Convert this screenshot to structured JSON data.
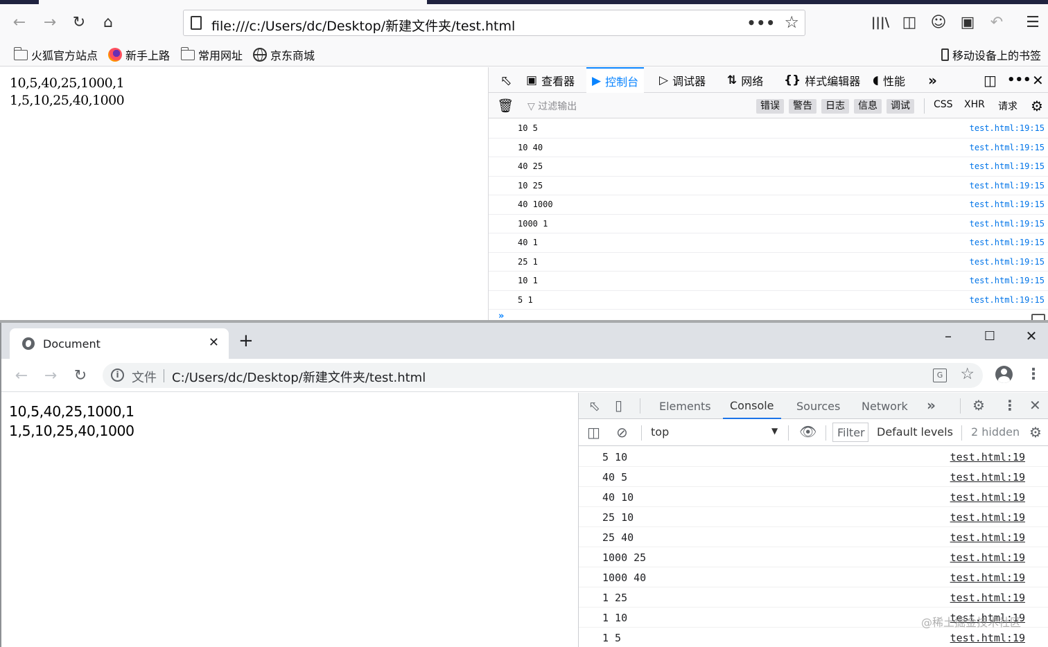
{
  "firefox": {
    "url": "file:///c:/Users/dc/Desktop/新建文件夹/test.html",
    "bookmarks": [
      "火狐官方站点",
      "新手上路",
      "常用网址",
      "京东商城"
    ],
    "mobile_bookmarks": "移动设备上的书签",
    "page_lines": [
      "10,5,40,25,1000,1",
      "1,5,10,25,40,1000"
    ],
    "devtools": {
      "tabs": [
        "查看器",
        "控制台",
        "调试器",
        "网络",
        "样式编辑器",
        "性能"
      ],
      "selected_tab": "控制台",
      "filter_placeholder": "过滤输出",
      "levels": [
        "错误",
        "警告",
        "日志",
        "信息",
        "调试"
      ],
      "categories": [
        "CSS",
        "XHR",
        "请求"
      ],
      "messages": [
        {
          "text": "10 5",
          "source": "test.html:19:15"
        },
        {
          "text": "10 40",
          "source": "test.html:19:15"
        },
        {
          "text": "40 25",
          "source": "test.html:19:15"
        },
        {
          "text": "10 25",
          "source": "test.html:19:15"
        },
        {
          "text": "40 1000",
          "source": "test.html:19:15"
        },
        {
          "text": "1000 1",
          "source": "test.html:19:15"
        },
        {
          "text": "40 1",
          "source": "test.html:19:15"
        },
        {
          "text": "25 1",
          "source": "test.html:19:15"
        },
        {
          "text": "10 1",
          "source": "test.html:19:15"
        },
        {
          "text": "5 1",
          "source": "test.html:19:15"
        }
      ]
    }
  },
  "chrome": {
    "tab_title": "Document",
    "scheme_label": "文件",
    "url": "C:/Users/dc/Desktop/新建文件夹/test.html",
    "page_lines": [
      "10,5,40,25,1000,1",
      "1,5,10,25,40,1000"
    ],
    "devtools": {
      "tabs": [
        "Elements",
        "Console",
        "Sources",
        "Network"
      ],
      "selected_tab": "Console",
      "context": "top",
      "filter_placeholder": "Filter",
      "levels": "Default levels",
      "hidden": "2 hidden",
      "messages": [
        {
          "text": "5 10",
          "source": "test.html:19"
        },
        {
          "text": "40 5",
          "source": "test.html:19"
        },
        {
          "text": "40 10",
          "source": "test.html:19"
        },
        {
          "text": "25 10",
          "source": "test.html:19"
        },
        {
          "text": "25 40",
          "source": "test.html:19"
        },
        {
          "text": "1000 25",
          "source": "test.html:19"
        },
        {
          "text": "1000 40",
          "source": "test.html:19"
        },
        {
          "text": "1 25",
          "source": "test.html:19"
        },
        {
          "text": "1 10",
          "source": "test.html:19"
        },
        {
          "text": "1 5",
          "source": "test.html:19"
        }
      ]
    }
  },
  "watermark": "@稀土掘金技术社区",
  "colors": {
    "firefox_accent": "#0a84ff",
    "firefox_link": "#0074e8",
    "chrome_accent": "#1a73e8"
  }
}
